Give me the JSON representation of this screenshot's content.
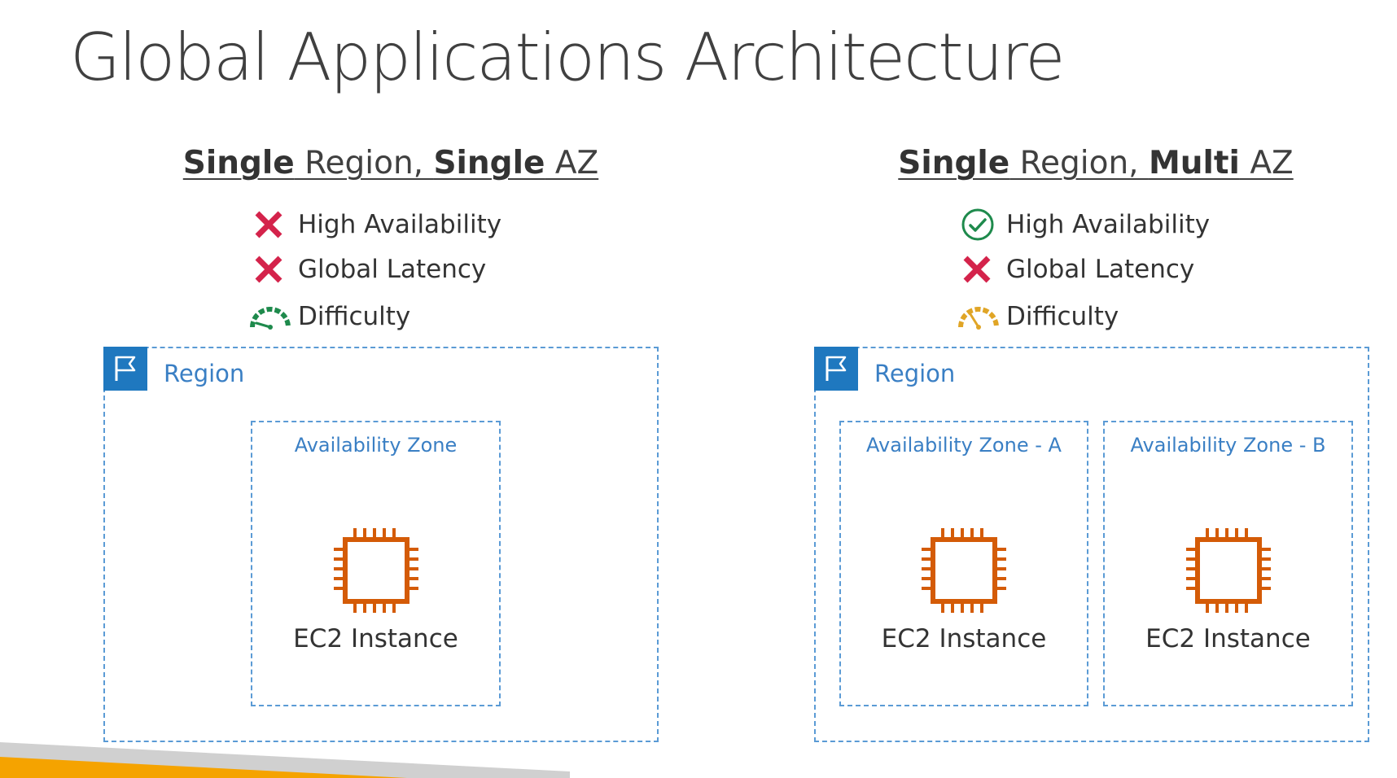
{
  "title": "Global Applications Architecture",
  "scenarios": [
    {
      "heading": {
        "part1": "Single",
        "part2": " Region, ",
        "part3": "Single",
        "part4": " AZ"
      },
      "features": [
        {
          "icon": "x-icon",
          "label": "High Availability",
          "color": "#d4234b"
        },
        {
          "icon": "x-icon",
          "label": "Global Latency",
          "color": "#d4234b"
        },
        {
          "icon": "gauge-icon",
          "label": "Difficulty",
          "color": "#1e8a4c",
          "level": "low"
        }
      ],
      "region_label": "Region",
      "zones": [
        {
          "label": "Availability Zone",
          "instance_label": "EC2 Instance"
        }
      ]
    },
    {
      "heading": {
        "part1": "Single",
        "part2": " Region, ",
        "part3": "Multi",
        "part4": " AZ"
      },
      "features": [
        {
          "icon": "check-circle-icon",
          "label": "High Availability",
          "color": "#1e8a4c"
        },
        {
          "icon": "x-icon",
          "label": "Global Latency",
          "color": "#d4234b"
        },
        {
          "icon": "gauge-icon",
          "label": "Difficulty",
          "color": "#e0a526",
          "level": "medium"
        }
      ],
      "region_label": "Region",
      "zones": [
        {
          "label": "Availability Zone - A",
          "instance_label": "EC2 Instance"
        },
        {
          "label": "Availability Zone - B",
          "instance_label": "EC2 Instance"
        }
      ]
    }
  ],
  "colors": {
    "region_flag": "#1f78bf",
    "dashed_border": "#5b9bd5",
    "ec2_orange": "#d45b07",
    "footer_orange": "#f5a300",
    "footer_gray": "#d0d0d0"
  }
}
